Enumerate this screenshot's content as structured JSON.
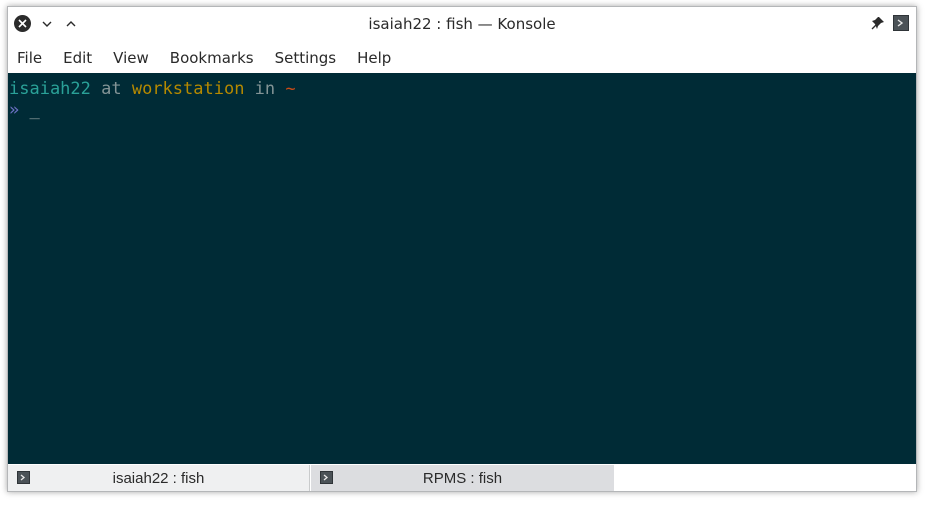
{
  "window": {
    "title": "isaiah22 : fish — Konsole"
  },
  "titlebar_icons": {
    "close": "close-icon",
    "minimize": "chevron-down-icon",
    "maximize": "chevron-up-icon",
    "pin": "pin-icon",
    "app": "konsole-app-icon"
  },
  "menu": {
    "items": [
      "File",
      "Edit",
      "View",
      "Bookmarks",
      "Settings",
      "Help"
    ]
  },
  "terminal": {
    "background": "#002b36",
    "prompt_user": "isaiah22",
    "prompt_at": " at ",
    "prompt_host": "workstation",
    "prompt_in": " in ",
    "prompt_dir": "~",
    "prompt_symbol": "»",
    "cursor": "_",
    "colors": {
      "user": "#2aa198",
      "plain": "#839496",
      "host": "#b58900",
      "dir": "#cb4b16",
      "prompt_symbol": "#6c71c4",
      "cursor": "#93a1a1"
    }
  },
  "tabs": [
    {
      "label": "isaiah22 : fish",
      "active": true
    },
    {
      "label": "RPMS : fish",
      "active": false
    }
  ]
}
